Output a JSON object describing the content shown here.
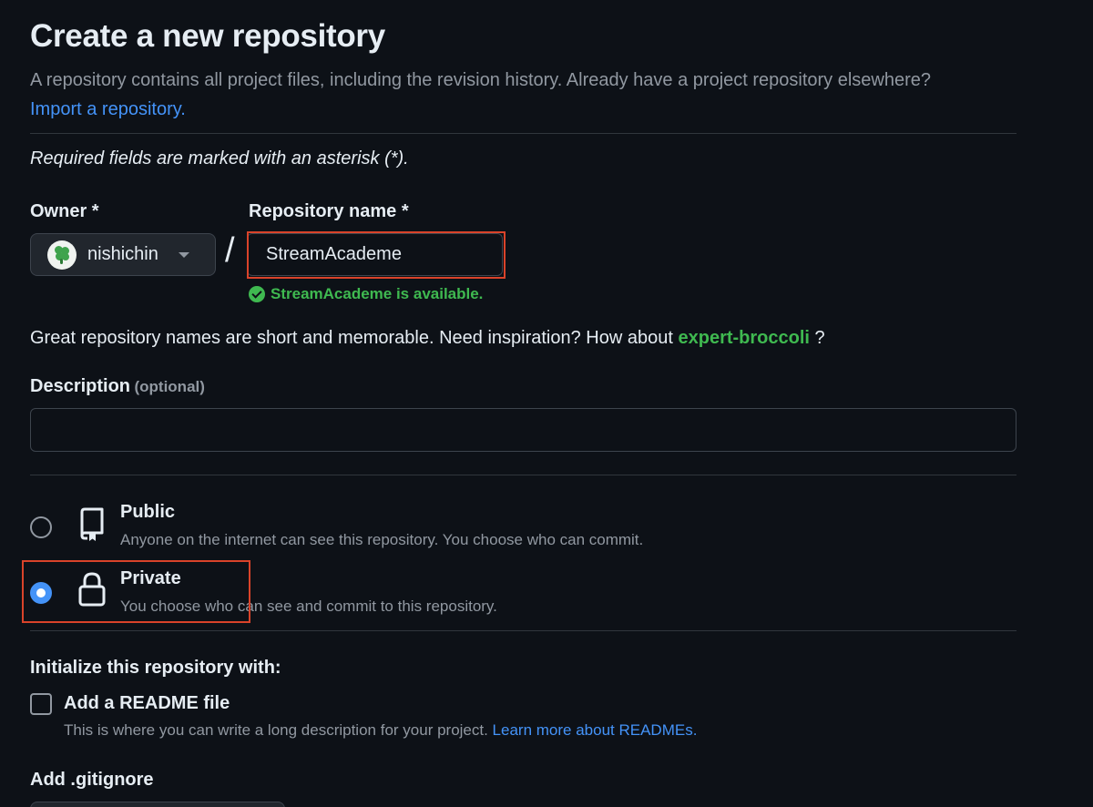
{
  "header": {
    "title": "Create a new repository",
    "intro_text": "A repository contains all project files, including the revision history. Already have a project repository elsewhere? ",
    "import_link": "Import a repository."
  },
  "required_note": "Required fields are marked with an asterisk (*).",
  "owner": {
    "label": "Owner *",
    "value": "nishichin"
  },
  "slash": "/",
  "repo_name": {
    "label": "Repository name *",
    "value": "StreamAcademe",
    "availability": "StreamAcademe is available."
  },
  "suggestion": {
    "prefix": "Great repository names are short and memorable. Need inspiration? How about ",
    "name": "expert-broccoli",
    "suffix": " ?"
  },
  "description": {
    "label": "Description",
    "optional": "(optional)",
    "value": ""
  },
  "visibility": {
    "selected": "private",
    "public": {
      "title": "Public",
      "desc": "Anyone on the internet can see this repository. You choose who can commit."
    },
    "private": {
      "title": "Private",
      "desc": "You choose who can see and commit to this repository."
    }
  },
  "initialize": {
    "heading": "Initialize this repository with:",
    "readme_label": "Add a README file",
    "readme_checked": false,
    "readme_desc": "This is where you can write a long description for your project. ",
    "readme_link": "Learn more about READMEs."
  },
  "gitignore": {
    "label": "Add .gitignore"
  },
  "icons": {
    "owner_avatar": "avatar-icon",
    "owner_dropdown": "triangle-down-icon",
    "available": "check-circle-fill-icon",
    "public": "repo-icon",
    "private": "lock-icon"
  },
  "colors": {
    "background": "#0d1117",
    "link": "#4493f8",
    "success": "#3fb950",
    "highlight": "#d9432a"
  }
}
